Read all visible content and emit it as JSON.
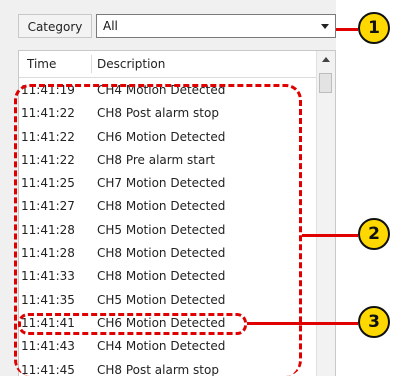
{
  "filter": {
    "label": "Category",
    "selected": "All"
  },
  "table": {
    "columns": {
      "time": "Time",
      "description": "Description"
    },
    "rows": [
      {
        "time": "11:41:19",
        "description": "CH4 Motion Detected"
      },
      {
        "time": "11:41:22",
        "description": "CH8 Post alarm stop"
      },
      {
        "time": "11:41:22",
        "description": "CH6 Motion Detected"
      },
      {
        "time": "11:41:22",
        "description": "CH8 Pre alarm start"
      },
      {
        "time": "11:41:25",
        "description": "CH7 Motion Detected"
      },
      {
        "time": "11:41:27",
        "description": "CH8 Motion Detected"
      },
      {
        "time": "11:41:28",
        "description": "CH5 Motion Detected"
      },
      {
        "time": "11:41:28",
        "description": "CH8 Motion Detected"
      },
      {
        "time": "11:41:33",
        "description": "CH8 Motion Detected"
      },
      {
        "time": "11:41:35",
        "description": "CH5 Motion Detected"
      },
      {
        "time": "11:41:41",
        "description": "CH6 Motion Detected"
      },
      {
        "time": "11:41:43",
        "description": "CH4 Motion Detected"
      },
      {
        "time": "11:41:45",
        "description": "CH8 Post alarm stop"
      }
    ]
  },
  "callouts": [
    "1",
    "2",
    "3"
  ],
  "colors": {
    "annotation": "#e00000",
    "badge": "#ffd800"
  }
}
